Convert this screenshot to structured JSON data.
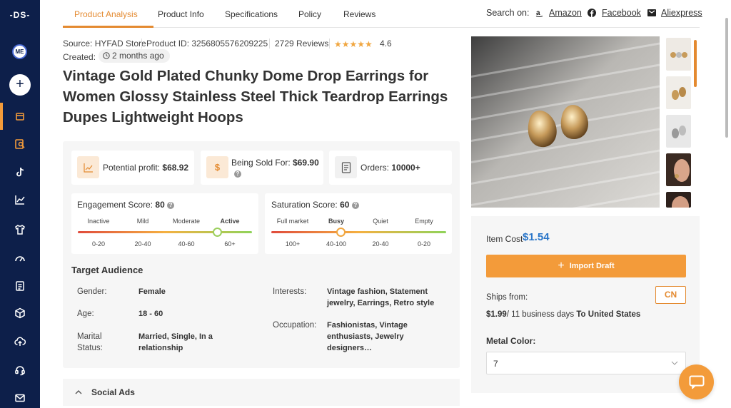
{
  "sidebar": {
    "logo": "-DS-",
    "avatar_initials": "ME",
    "add_label": "+",
    "icons": [
      "store-icon",
      "search-product-icon",
      "tiktok-icon",
      "trending-chart-icon",
      "shirt-icon",
      "speedometer-icon",
      "document-icon",
      "cube-icon",
      "cloud-upload-icon",
      "support-icon",
      "mail-icon"
    ]
  },
  "tabs": [
    "Product Analysis",
    "Product Info",
    "Specifications",
    "Policy",
    "Reviews"
  ],
  "search_on": {
    "label": "Search on:",
    "stores": [
      "Amazon",
      "Facebook",
      "Aliexpress"
    ]
  },
  "meta": {
    "source": "Source: HYFAD Store",
    "product_id": "Product ID: 3256805576209225",
    "reviews": "2729 Reviews",
    "stars": "★★★★★",
    "rating": "4.6",
    "created_label": "Created:",
    "created_value": "2 months ago"
  },
  "product": {
    "title": "Vintage Gold Plated Chunky Dome Drop Earrings for Women Glossy Stainless Steel Thick Teardrop Earrings Dupes Lightweight Hoops"
  },
  "metrics": {
    "profit_label": "Potential profit:",
    "profit_value": "$68.92",
    "sold_label": "Being Sold For:",
    "sold_value": "$69.90",
    "orders_label": "Orders:",
    "orders_value": "10000+"
  },
  "engagement": {
    "title": "Engagement Score:",
    "value": "80",
    "levels": [
      "Inactive",
      "Mild",
      "Moderate",
      "Active"
    ],
    "ranges": [
      "0-20",
      "20-40",
      "40-60",
      "60+"
    ],
    "active_index": 3,
    "level_fraction": 0.8
  },
  "saturation": {
    "title": "Saturation Score:",
    "value": "60",
    "levels": [
      "Full market",
      "Busy",
      "Quiet",
      "Empty"
    ],
    "ranges": [
      "100+",
      "40-100",
      "20-40",
      "0-20"
    ],
    "active_index": 1,
    "level_fraction": 0.4
  },
  "audience": {
    "heading": "Target Audience",
    "gender_label": "Gender:",
    "gender_value": "Female",
    "age_label": "Age:",
    "age_value": "18 - 60",
    "marital_label": "Marital Status:",
    "marital_value": "Married, Single, In a relationship",
    "interests_label": "Interests:",
    "interests_value": "Vintage fashion, Statement jewelry, Earrings, Retro style",
    "occupation_label": "Occupation:",
    "occupation_value": "Fashionistas, Vintage enthusiasts, Jewelry designers…"
  },
  "social_ads": "Social Ads",
  "buy": {
    "item_cost_label": "Item Cost",
    "item_cost_value": "$1.54",
    "import_label": "Import Draft",
    "ships_from_label": "Ships from:",
    "ships_from_value": "CN",
    "ship_price": "$1.99",
    "ship_days": "/ 11 business days",
    "ship_dest": "To United States",
    "metal_label": "Metal Color:",
    "metal_value": "7"
  },
  "colors": {
    "sidebar": "#0d1f4a",
    "accent": "#e48a30",
    "price_blue": "#2a76c9"
  }
}
